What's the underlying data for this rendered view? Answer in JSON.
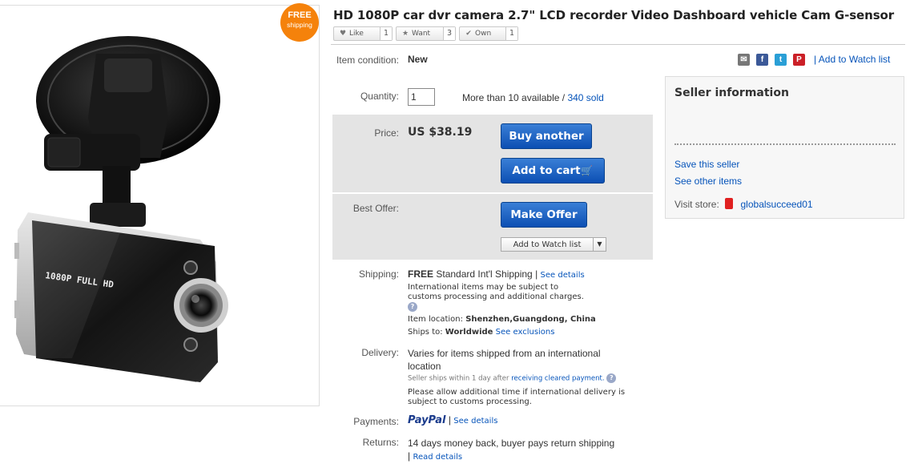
{
  "badge": {
    "line1": "FREE",
    "line2": "shipping"
  },
  "product": {
    "title": "HD 1080P car dvr camera 2.7\" LCD recorder Video Dashboard vehicle Cam G-sensor",
    "camera_label": "1080P FULL HD"
  },
  "social": [
    {
      "label": "Like",
      "count": "1",
      "icon": "heart-icon"
    },
    {
      "label": "Want",
      "count": "3",
      "icon": "star-icon"
    },
    {
      "label": "Own",
      "count": "1",
      "icon": "check-icon"
    }
  ],
  "share": {
    "watch_link": "| Add to Watch list",
    "icons": [
      "email-icon",
      "facebook-icon",
      "twitter-icon",
      "pinterest-icon"
    ]
  },
  "condition": {
    "label": "Item condition:",
    "value": "New"
  },
  "quantity": {
    "label": "Quantity:",
    "value": "1",
    "available": "More than 10 available /",
    "sold": "340 sold"
  },
  "price": {
    "label": "Price:",
    "value": "US $38.19",
    "buy": "Buy another",
    "cart": "Add to cart"
  },
  "offer": {
    "label": "Best Offer:",
    "make": "Make Offer",
    "watch": "Add to Watch list"
  },
  "shipping": {
    "label": "Shipping:",
    "free": "FREE",
    "method": "Standard Int'l Shipping |",
    "details": "See details",
    "note": "International items may be subject to customs processing and additional charges.",
    "location_label": "Item location:",
    "location": "Shenzhen,Guangdong, China",
    "ships_label": "Ships to:",
    "ships": "Worldwide",
    "exclusions": "See exclusions"
  },
  "delivery": {
    "label": "Delivery:",
    "value": "Varies for items shipped from an international location",
    "handling": "Seller ships within 1 day after",
    "handling_link": "receiving cleared payment.",
    "note": "Please allow additional time if international delivery is subject to customs processing."
  },
  "payments": {
    "label": "Payments:",
    "brand": "PayPal",
    "sep": "|",
    "details": "See details"
  },
  "returns": {
    "label": "Returns:",
    "value": "14 days money back, buyer pays return shipping |",
    "details": "Read details"
  },
  "seller": {
    "heading": "Seller information",
    "save": "Save this seller",
    "other": "See other items",
    "visit": "Visit store:",
    "store": "globalsucceed01"
  },
  "colors": {
    "buy_button": "#0c4fb3",
    "badge": "#f5820b",
    "link": "#0654ba"
  }
}
